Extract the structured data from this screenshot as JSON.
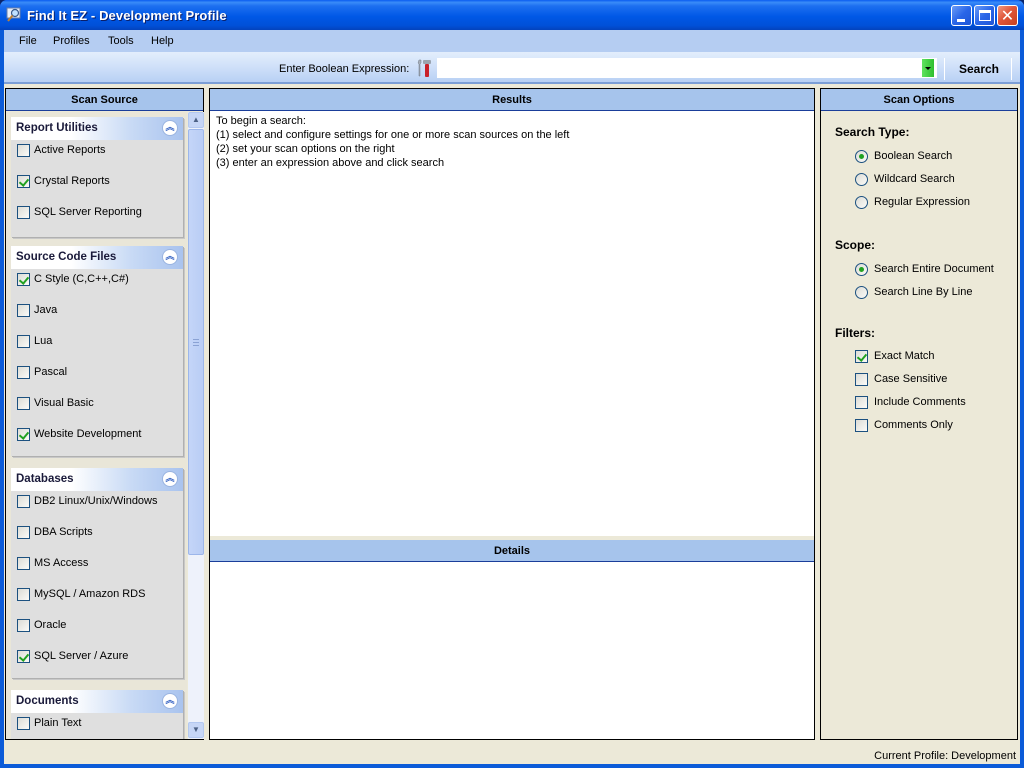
{
  "window": {
    "title": "Find It EZ - Development Profile",
    "icon": "magnifier-app-icon"
  },
  "menu": {
    "items": [
      "File",
      "Profiles",
      "Tools",
      "Help"
    ]
  },
  "toolbar": {
    "expression_label": "Enter Boolean Expression:",
    "expression_value": "",
    "search_label": "Search",
    "tools_icon": "hammer-wrench-icon"
  },
  "scan_source": {
    "title": "Scan Source",
    "groups": [
      {
        "title": "Report Utilities",
        "items": [
          {
            "label": "Active Reports",
            "checked": false
          },
          {
            "label": "Crystal Reports",
            "checked": true
          },
          {
            "label": "SQL Server Reporting",
            "checked": false
          }
        ]
      },
      {
        "title": "Source Code Files",
        "items": [
          {
            "label": "C Style (C,C++,C#)",
            "checked": true
          },
          {
            "label": "Java",
            "checked": false
          },
          {
            "label": "Lua",
            "checked": false
          },
          {
            "label": "Pascal",
            "checked": false
          },
          {
            "label": "Visual Basic",
            "checked": false
          },
          {
            "label": "Website Development",
            "checked": true
          }
        ]
      },
      {
        "title": "Databases",
        "items": [
          {
            "label": "DB2 Linux/Unix/Windows",
            "checked": false
          },
          {
            "label": "DBA Scripts",
            "checked": false
          },
          {
            "label": "MS Access",
            "checked": false
          },
          {
            "label": "MySQL / Amazon RDS",
            "checked": false
          },
          {
            "label": "Oracle",
            "checked": false
          },
          {
            "label": "SQL Server / Azure",
            "checked": true
          }
        ]
      },
      {
        "title": "Documents",
        "items": [
          {
            "label": "Plain Text",
            "checked": false
          }
        ]
      }
    ]
  },
  "results": {
    "title": "Results",
    "lines": [
      "To begin a search:",
      "(1) select and configure settings for one or more scan sources on the left",
      "(2) set your scan options on the right",
      "(3) enter an expression above and click search"
    ]
  },
  "details": {
    "title": "Details"
  },
  "scan_options": {
    "title": "Scan Options",
    "search_type": {
      "label": "Search Type:",
      "options": [
        {
          "label": "Boolean Search",
          "selected": true
        },
        {
          "label": "Wildcard Search",
          "selected": false
        },
        {
          "label": "Regular Expression",
          "selected": false
        }
      ]
    },
    "scope": {
      "label": "Scope:",
      "options": [
        {
          "label": "Search Entire Document",
          "selected": true
        },
        {
          "label": "Search Line By Line",
          "selected": false
        }
      ]
    },
    "filters": {
      "label": "Filters:",
      "options": [
        {
          "label": "Exact Match",
          "checked": true
        },
        {
          "label": "Case Sensitive",
          "checked": false
        },
        {
          "label": "Include Comments",
          "checked": false
        },
        {
          "label": "Comments Only",
          "checked": false
        }
      ]
    }
  },
  "status": {
    "text": "Current Profile: Development"
  }
}
